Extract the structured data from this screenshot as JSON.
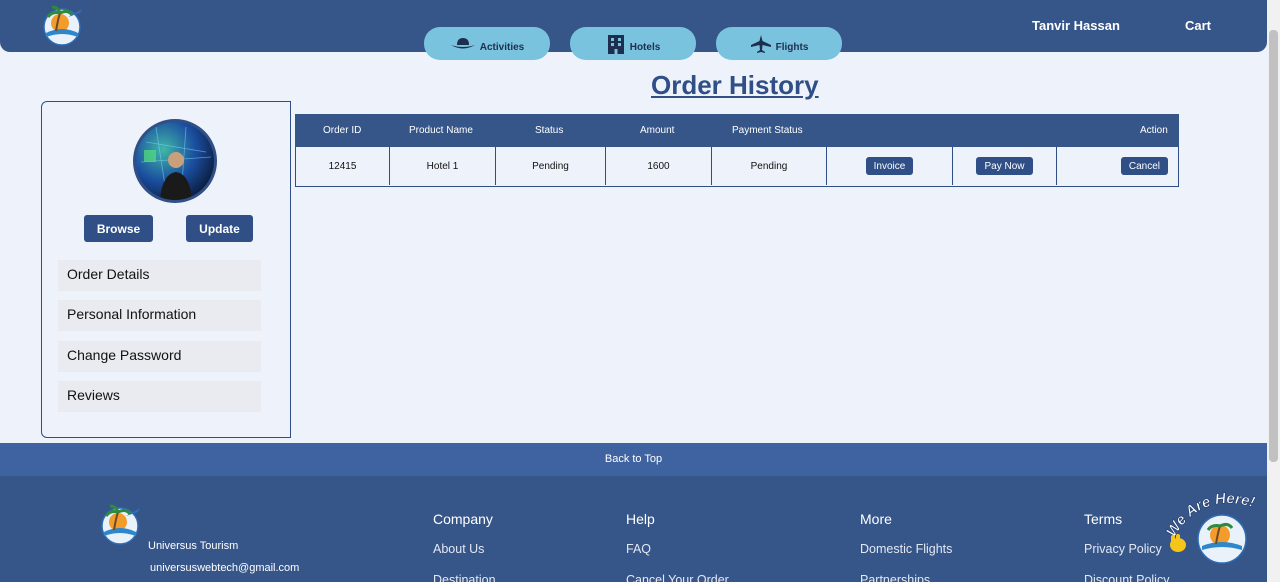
{
  "header": {
    "user_name": "Tanvir Hassan",
    "cart_label": "Cart",
    "tabs": [
      {
        "label": "Activities",
        "icon": "hat-icon"
      },
      {
        "label": "Hotels",
        "icon": "building-icon"
      },
      {
        "label": "Flights",
        "icon": "airplane-icon"
      }
    ]
  },
  "page_title": "Order History",
  "sidebar": {
    "browse_label": "Browse",
    "update_label": "Update",
    "menu": [
      "Order Details",
      "Personal Information",
      "Change Password",
      "Reviews"
    ]
  },
  "orders": {
    "columns": [
      "Order ID",
      "Product Name",
      "Status",
      "Amount",
      "Payment Status",
      "Action"
    ],
    "rows": [
      {
        "order_id": "12415",
        "product_name": "Hotel 1",
        "status": "Pending",
        "amount": "1600",
        "payment_status": "Pending",
        "invoice_label": "Invoice",
        "pay_label": "Pay Now",
        "cancel_label": "Cancel"
      }
    ]
  },
  "footer": {
    "back_to_top": "Back to Top",
    "brand": "Universus Tourism",
    "email": "universuswebtech@gmail.com",
    "columns": [
      {
        "heading": "Company",
        "links": [
          "About Us",
          "Destination"
        ]
      },
      {
        "heading": "Help",
        "links": [
          "FAQ",
          "Cancel Your Order"
        ]
      },
      {
        "heading": "More",
        "links": [
          "Domestic Flights",
          "Partnerships"
        ]
      },
      {
        "heading": "Terms",
        "links": [
          "Privacy Policy",
          "Discount Policy"
        ]
      }
    ],
    "chat_badge": "We Are Here!"
  },
  "colors": {
    "primary": "#36568a",
    "tab_bg": "#79c3de",
    "page_bg": "#eef2fa"
  }
}
